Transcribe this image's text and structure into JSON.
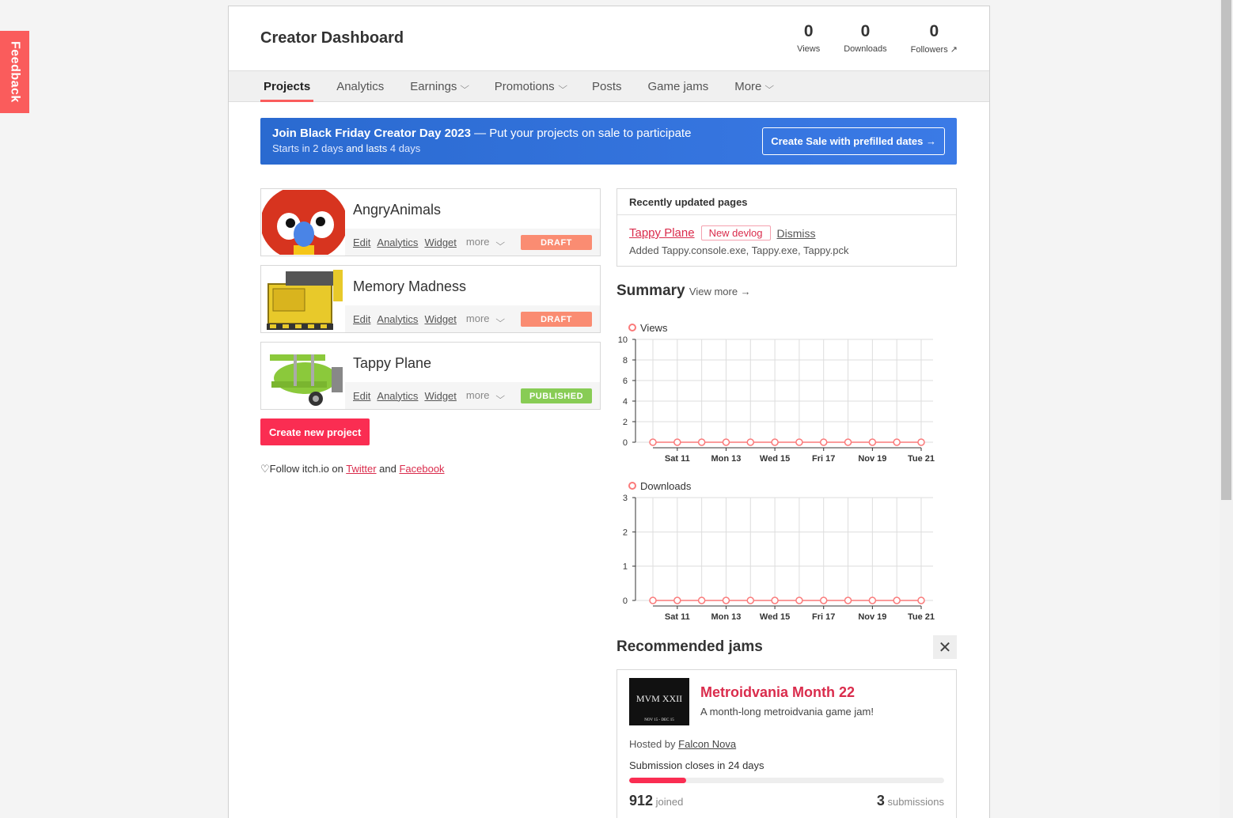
{
  "feedback": "Feedback",
  "header": {
    "title": "Creator Dashboard",
    "stats": [
      {
        "value": "0",
        "label": "Views"
      },
      {
        "value": "0",
        "label": "Downloads"
      },
      {
        "value": "0",
        "label": "Followers ↗"
      }
    ]
  },
  "tabs": [
    "Projects",
    "Analytics",
    "Earnings",
    "Promotions",
    "Posts",
    "Game jams",
    "More"
  ],
  "banner": {
    "title": "Join Black Friday Creator Day 2023",
    "title_rest": " — Put your projects on sale to participate",
    "starts_pre": "Starts ",
    "starts": "in 2 days",
    "lasts_pre": " and lasts ",
    "lasts": "4 days",
    "button": "Create Sale with prefilled dates →"
  },
  "projects": [
    {
      "title": "AngryAnimals",
      "status": "DRAFT"
    },
    {
      "title": "Memory Madness",
      "status": "DRAFT"
    },
    {
      "title": "Tappy Plane",
      "status": "PUBLISHED"
    }
  ],
  "project_actions": {
    "edit": "Edit",
    "analytics": "Analytics",
    "widget": "Widget",
    "more": "more"
  },
  "create_project": "Create new project",
  "follow": {
    "pre": "Follow itch.io on ",
    "twitter": "Twitter",
    "and": " and ",
    "facebook": "Facebook"
  },
  "recent": {
    "heading": "Recently updated pages",
    "page": "Tappy Plane",
    "tag": "New devlog",
    "dismiss": "Dismiss",
    "sub": "Added Tappy.console.exe, Tappy.exe, Tappy.pck"
  },
  "summary": {
    "title": "Summary",
    "view_more": "View more →"
  },
  "chart_data": [
    {
      "type": "line",
      "legend": "Views",
      "x_ticks": [
        "Sat 11",
        "Mon 13",
        "Wed 15",
        "Fri 17",
        "Nov 19",
        "Tue 21"
      ],
      "y_ticks": [
        0,
        2,
        4,
        6,
        8,
        10
      ],
      "ylim": [
        0,
        10
      ],
      "values": [
        0,
        0,
        0,
        0,
        0,
        0,
        0,
        0,
        0,
        0,
        0,
        0
      ],
      "color": "#fa7a7a"
    },
    {
      "type": "line",
      "legend": "Downloads",
      "x_ticks": [
        "Sat 11",
        "Mon 13",
        "Wed 15",
        "Fri 17",
        "Nov 19",
        "Tue 21"
      ],
      "y_ticks": [
        0,
        1,
        2,
        3
      ],
      "ylim": [
        0,
        3
      ],
      "values": [
        0,
        0,
        0,
        0,
        0,
        0,
        0,
        0,
        0,
        0,
        0,
        0
      ],
      "color": "#fa7a7a"
    }
  ],
  "jams": {
    "heading": "Recommended jams",
    "close": "✕",
    "image_title": "MVM XXII",
    "image_dates": "NOV 15 - DEC 15",
    "title": "Metroidvania Month 22",
    "desc": "A month-long metroidvania game jam!",
    "hosted_pre": "Hosted by ",
    "host": "Falcon Nova",
    "closes": "Submission closes in 24 days",
    "progress": 0.18,
    "joined": "912",
    "joined_lbl": "joined",
    "subs": "3",
    "subs_lbl": "submissions"
  }
}
